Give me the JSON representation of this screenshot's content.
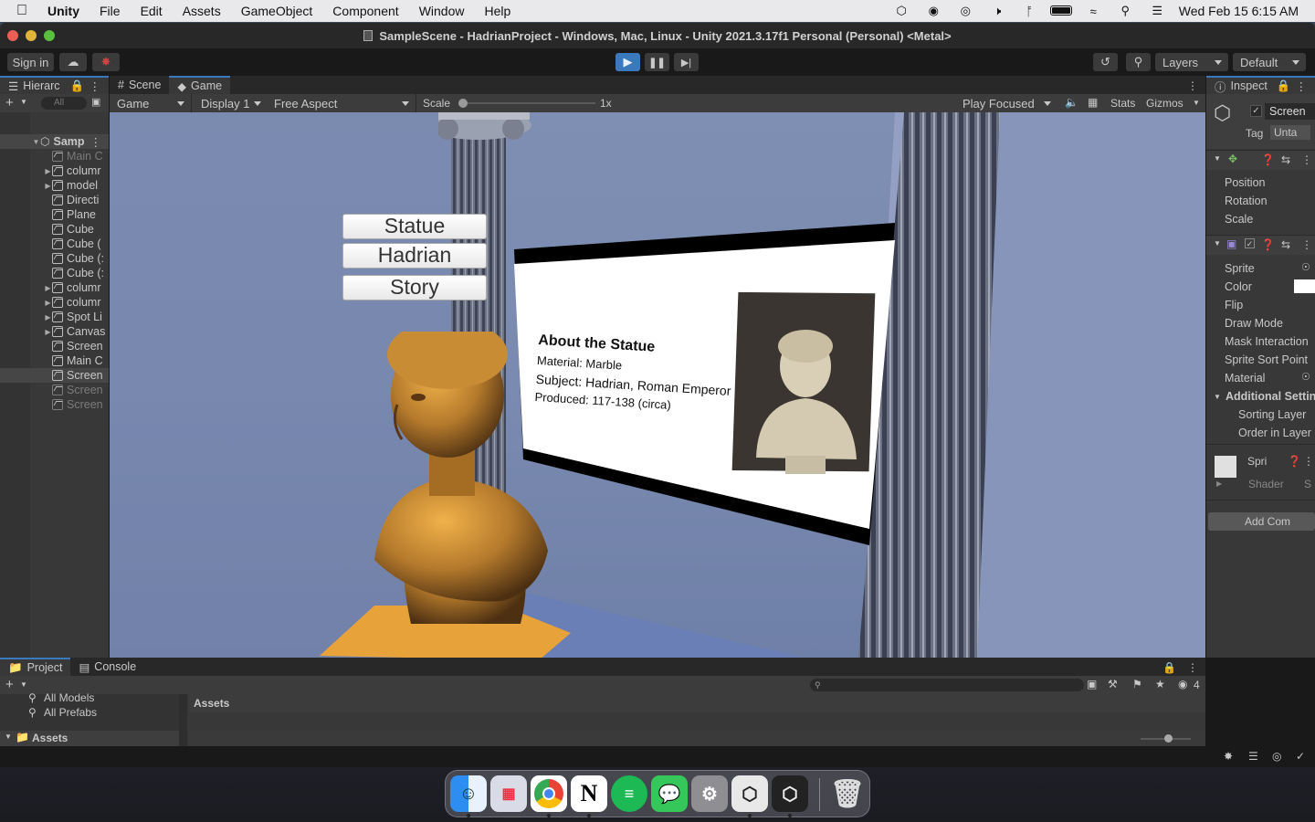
{
  "menubar": {
    "app_name": "Unity",
    "menus": [
      "File",
      "Edit",
      "Assets",
      "GameObject",
      "Component",
      "Window",
      "Help"
    ],
    "clock": "Wed Feb 15  6:15 AM"
  },
  "window": {
    "title": "SampleScene - HadrianProject - Windows, Mac, Linux - Unity 2021.3.17f1 Personal (Personal) <Metal>"
  },
  "toolbar": {
    "sign_in": "Sign in",
    "layers": "Layers",
    "layout": "Default"
  },
  "hierarchy": {
    "tab": "Hierarc",
    "search_placeholder": "All",
    "scene": "Samp",
    "items": [
      {
        "label": "Main C",
        "dim": true,
        "arrow": false
      },
      {
        "label": "columr",
        "dim": false,
        "arrow": true
      },
      {
        "label": "model",
        "dim": false,
        "arrow": true
      },
      {
        "label": "Directi",
        "dim": false,
        "arrow": false
      },
      {
        "label": "Plane",
        "dim": false,
        "arrow": false
      },
      {
        "label": "Cube",
        "dim": false,
        "arrow": false
      },
      {
        "label": "Cube (",
        "dim": false,
        "arrow": false
      },
      {
        "label": "Cube (:",
        "dim": false,
        "arrow": false
      },
      {
        "label": "Cube (:",
        "dim": false,
        "arrow": false
      },
      {
        "label": "columr",
        "dim": false,
        "arrow": true
      },
      {
        "label": "columr",
        "dim": false,
        "arrow": true
      },
      {
        "label": "Spot Li",
        "dim": false,
        "arrow": true
      },
      {
        "label": "Canvas",
        "dim": false,
        "arrow": true
      },
      {
        "label": "Screen",
        "dim": false,
        "arrow": false
      },
      {
        "label": "Main C",
        "dim": false,
        "arrow": false
      },
      {
        "label": "Screen",
        "dim": false,
        "arrow": false
      },
      {
        "label": "Screen",
        "dim": true,
        "arrow": false
      },
      {
        "label": "Screen",
        "dim": true,
        "arrow": false
      }
    ]
  },
  "game_view": {
    "tabs": {
      "scene": "Scene",
      "game": "Game"
    },
    "mode": "Game",
    "display": "Display 1",
    "aspect": "Free Aspect",
    "scale_label": "Scale",
    "scale_value": "1x",
    "play_mode": "Play Focused",
    "stats": "Stats",
    "gizmos": "Gizmos",
    "buttons": [
      "Statue",
      "Hadrian",
      "Story"
    ],
    "panel": {
      "heading": "About the Statue",
      "material": "Material: Marble",
      "subject": "Subject: Hadrian, Roman Emperor",
      "produced": "Produced: 117-138 (circa)"
    }
  },
  "inspector": {
    "tab": "Inspect",
    "object_name": "Screen",
    "tag_label": "Tag",
    "tag_value": "Unta",
    "transform": [
      "Position",
      "Rotation",
      "Scale"
    ],
    "sprite_fields": [
      "Sprite",
      "Color",
      "Flip",
      "Draw Mode",
      "Mask Interaction",
      "Sprite Sort Point",
      "Material"
    ],
    "additional_settings": "Additional Settin",
    "additional_fields": [
      "Sorting Layer",
      "Order in Layer"
    ],
    "material_name": "Spri",
    "shader_label": "Shader",
    "shader_value": "S",
    "add_component": "Add Com"
  },
  "project": {
    "tabs": {
      "project": "Project",
      "console": "Console"
    },
    "favorites": [
      "All Models",
      "All Prefabs"
    ],
    "assets_root": "Assets",
    "breadcrumb": "Assets",
    "hidden_count": "4"
  },
  "colors": {
    "accent": "#3a79bb",
    "panel": "#383838",
    "dark": "#282828"
  }
}
